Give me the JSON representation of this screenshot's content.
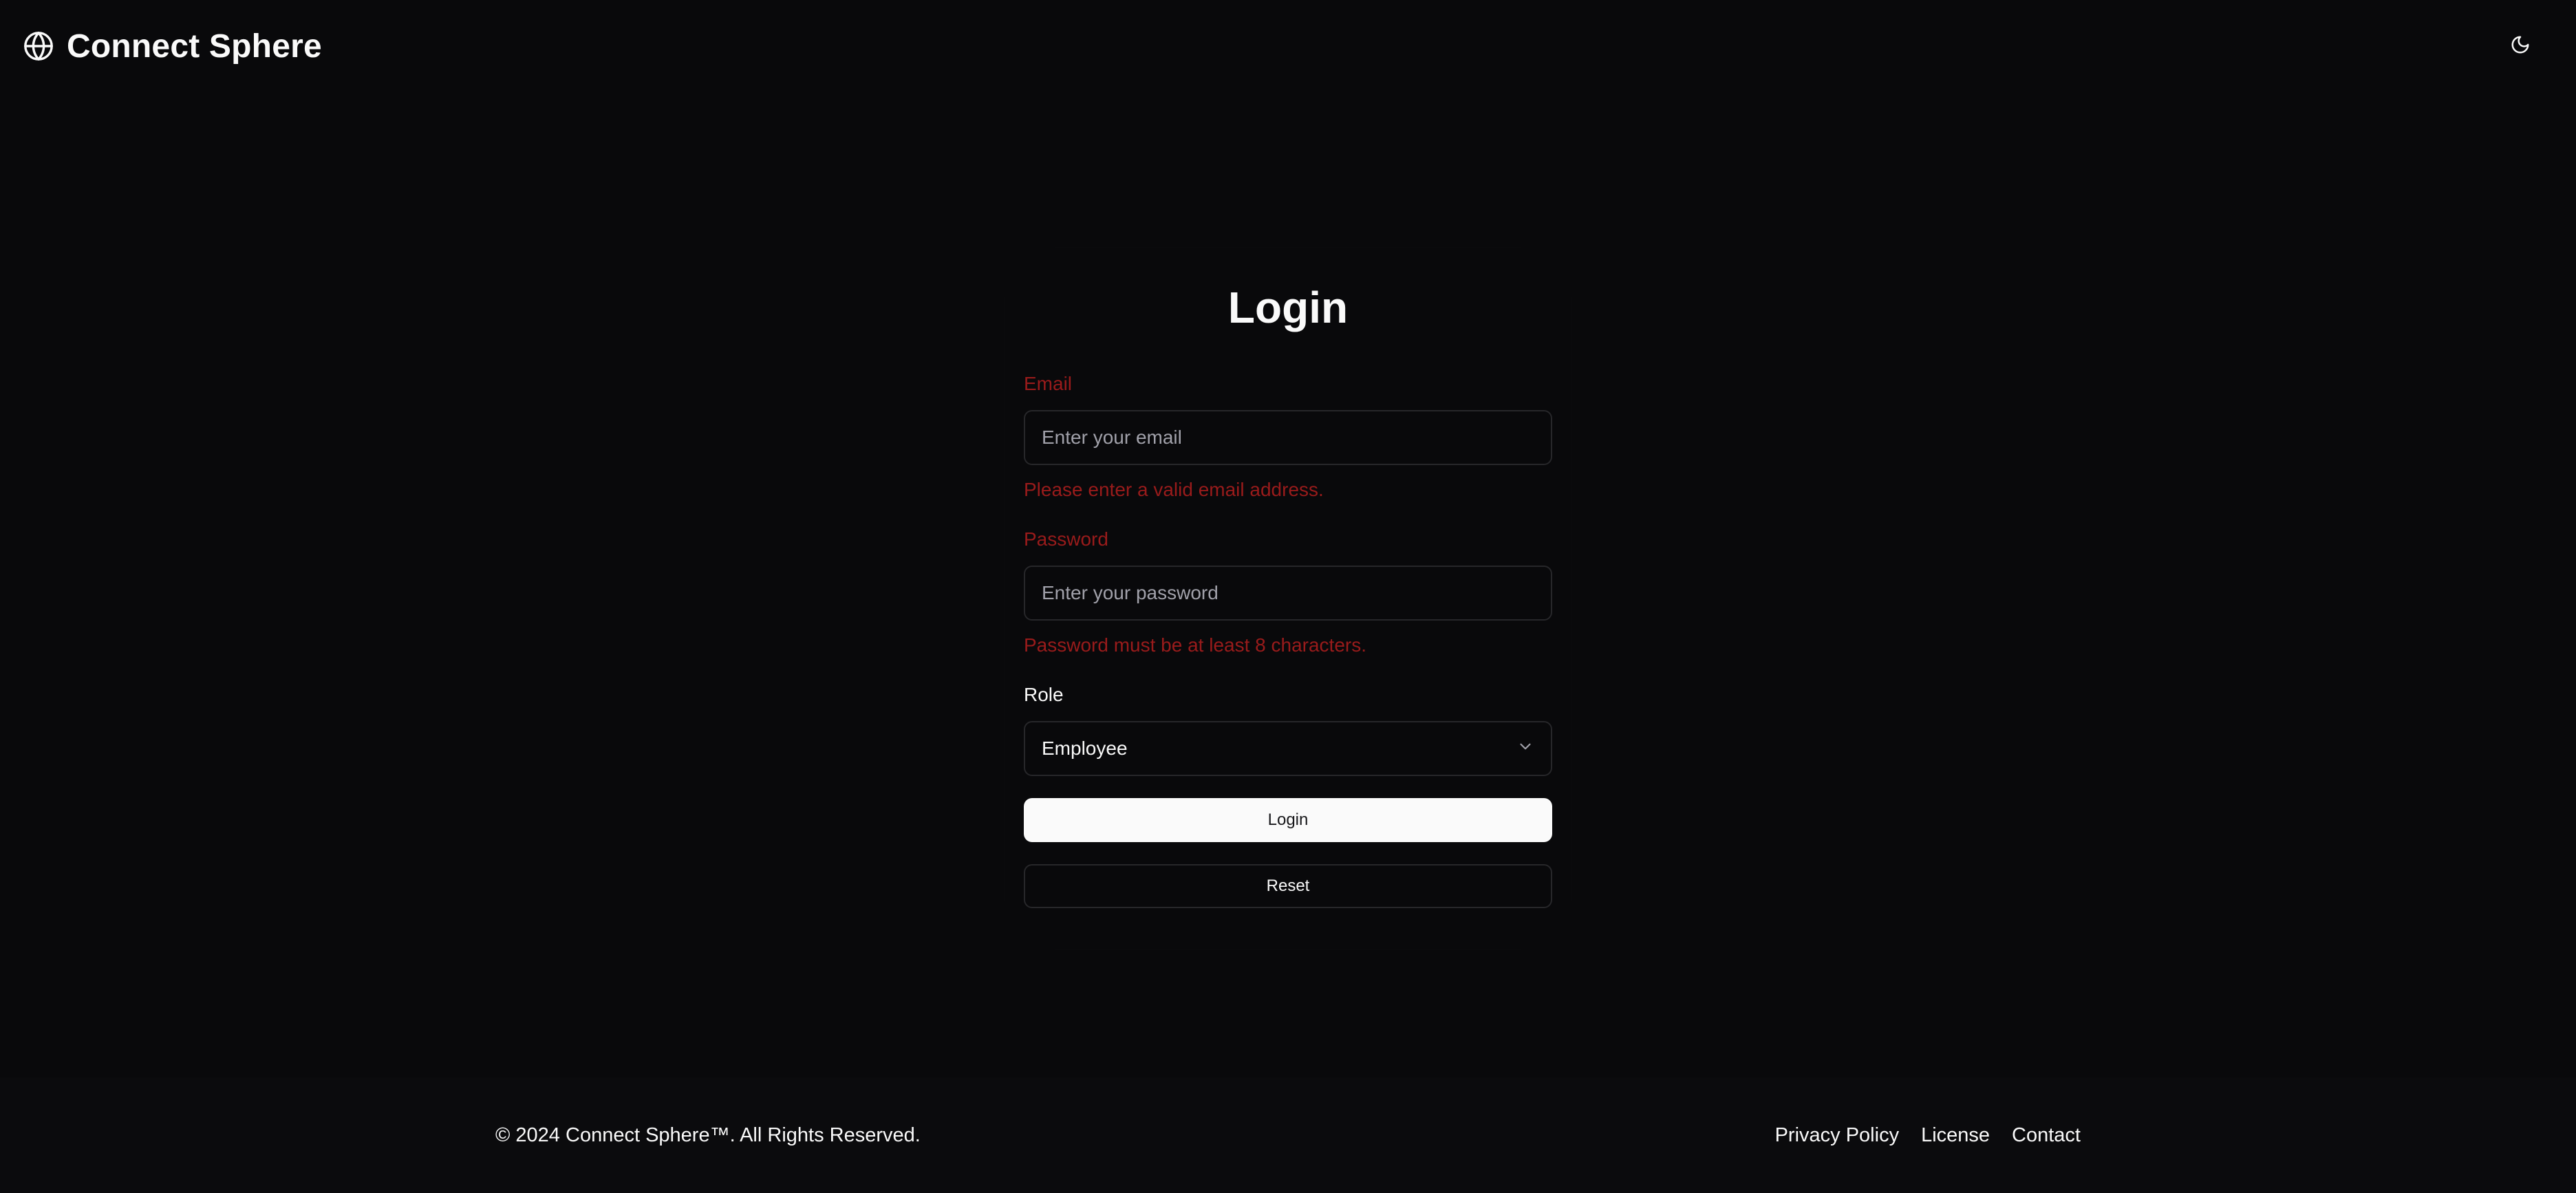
{
  "header": {
    "brand_icon": "globe-icon",
    "brand_name": "Connect Sphere",
    "theme_toggle_icon": "moon-icon"
  },
  "form": {
    "title": "Login",
    "email": {
      "label": "Email",
      "value": "",
      "placeholder": "Enter your email",
      "error": "Please enter a valid email address."
    },
    "password": {
      "label": "Password",
      "value": "",
      "placeholder": "Enter your password",
      "error": "Password must be at least 8 characters."
    },
    "role": {
      "label": "Role",
      "selected": "Employee",
      "icon": "chevron-down-icon"
    },
    "login_label": "Login",
    "reset_label": "Reset"
  },
  "footer": {
    "copyright": "© 2024 Connect Sphere™. All Rights Reserved.",
    "links": [
      {
        "label": "Privacy Policy"
      },
      {
        "label": "License"
      },
      {
        "label": "Contact"
      }
    ]
  },
  "colors": {
    "background": "#09090b",
    "error": "#991b1b",
    "primary_button": "#fafafa",
    "border": "#27272a"
  }
}
